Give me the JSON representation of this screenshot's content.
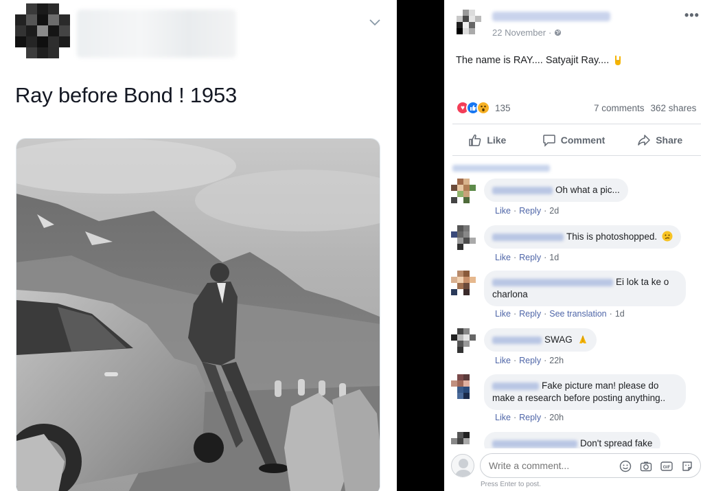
{
  "tweet": {
    "text": "Ray before Bond ! 1953"
  },
  "facebook_post": {
    "date": "22 November",
    "more_label": "•••",
    "text": "The name is RAY.... Satyajit Ray....",
    "reaction_count": "135",
    "comments_count": "7 comments",
    "shares_count": "362 shares",
    "actions": {
      "like": "Like",
      "comment": "Comment",
      "share": "Share"
    },
    "comments": [
      {
        "text": "Oh what a pic...",
        "like": "Like",
        "reply": "Reply",
        "time": "2d"
      },
      {
        "text": "This is photoshopped.",
        "like": "Like",
        "reply": "Reply",
        "time": "1d"
      },
      {
        "text": "Ei lok ta ke o",
        "text2": "charlona",
        "like": "Like",
        "reply": "Reply",
        "see_translation": "See translation",
        "time": "1d"
      },
      {
        "text": "SWAG",
        "like": "Like",
        "reply": "Reply",
        "time": "22h"
      },
      {
        "text": "Fake picture man! please do",
        "text2": "make a research before posting anything..",
        "like": "Like",
        "reply": "Reply",
        "time": "20h"
      },
      {
        "text": "Don't spread fake"
      }
    ],
    "write_placeholder": "Write a comment...",
    "press_enter": "Press Enter to post."
  },
  "colors": {
    "link": "#4f66a8",
    "love": "#f33e58",
    "like": "#1877f2",
    "wow": "#f7b125"
  }
}
